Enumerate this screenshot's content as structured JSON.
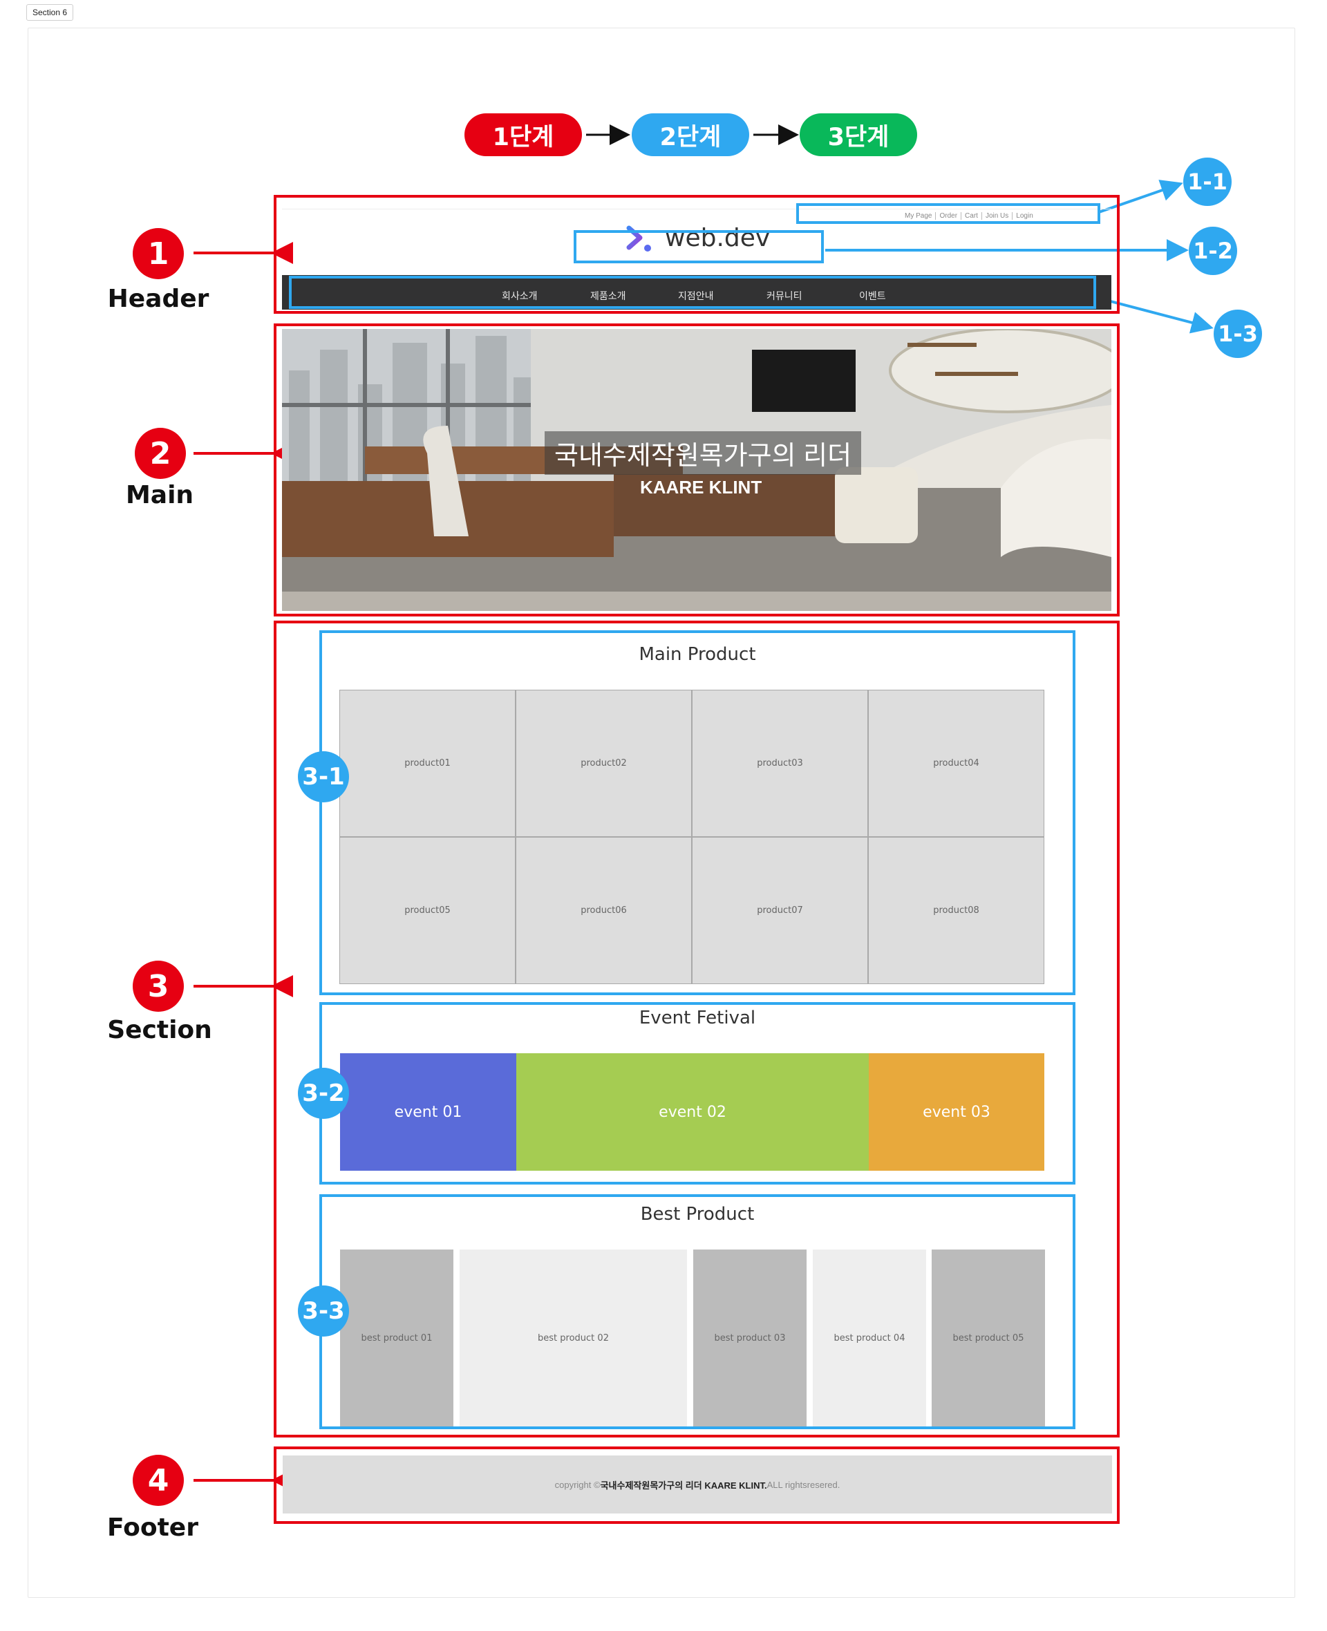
{
  "section_tag": "Section 6",
  "steps": [
    {
      "label": "1단계",
      "color": "#e60012"
    },
    {
      "label": "2단계",
      "color": "#2fa8f0"
    },
    {
      "label": "3단계",
      "color": "#09b85a"
    }
  ],
  "labels": {
    "header": {
      "num": "1",
      "name": "Header"
    },
    "main": {
      "num": "2",
      "name": "Main"
    },
    "section": {
      "num": "3",
      "name": "Section"
    },
    "footer": {
      "num": "4",
      "name": "Footer"
    }
  },
  "sub_badges": {
    "b1_1": "1-1",
    "b1_2": "1-2",
    "b1_3": "1-3",
    "b3_1": "3-1",
    "b3_2": "3-2",
    "b3_3": "3-3"
  },
  "header": {
    "util_links": [
      "My Page",
      "Order",
      "Cart",
      "Join Us",
      "Login"
    ],
    "logo": "web.dev",
    "nav": [
      "회사소개",
      "제품소개",
      "지점안내",
      "커뮤니티",
      "이벤트"
    ]
  },
  "hero": {
    "title": "국내수제작원목가구의 리더",
    "subtitle": "KAARE KLINT"
  },
  "main_product": {
    "title": "Main Product",
    "items": [
      "product01",
      "product02",
      "product03",
      "product04",
      "product05",
      "product06",
      "product07",
      "product08"
    ]
  },
  "event": {
    "title": "Event Fetival",
    "items": [
      {
        "label": "event 01",
        "color": "#5a6bd9"
      },
      {
        "label": "event 02",
        "color": "#a5cc52"
      },
      {
        "label": "event 03",
        "color": "#e8a93c"
      }
    ]
  },
  "best_product": {
    "title": "Best Product",
    "items": [
      "best product 01",
      "best product 02",
      "best product 03",
      "best product 04",
      "best product 05"
    ]
  },
  "footer": {
    "prefix": "copyright ©",
    "bold": "국내수제작원목가구의 리더 KAARE KLINT.",
    "suffix": " ALL rightsresered."
  },
  "colors": {
    "red": "#e60012",
    "blue": "#2fa8f0",
    "green": "#09b85a"
  }
}
